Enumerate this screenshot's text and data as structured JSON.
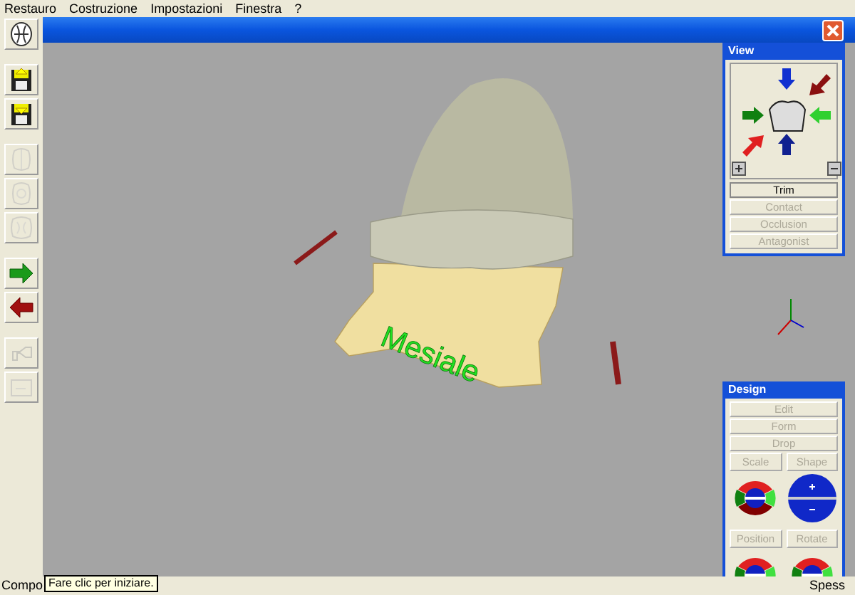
{
  "menu": [
    "Restauro",
    "Costruzione",
    "Impostazioni",
    "Finestra",
    "?"
  ],
  "toolbar_groups": [
    [
      {
        "kind": "occlusal",
        "disabled": false
      }
    ],
    [
      {
        "kind": "save-up",
        "disabled": false
      },
      {
        "kind": "save-down",
        "disabled": false
      }
    ],
    [
      {
        "kind": "tooth-a",
        "disabled": true
      },
      {
        "kind": "tooth-b",
        "disabled": true
      },
      {
        "kind": "tooth-c",
        "disabled": true
      }
    ],
    [
      {
        "kind": "arrow-right",
        "disabled": false
      },
      {
        "kind": "arrow-left",
        "disabled": false
      }
    ],
    [
      {
        "kind": "tool",
        "disabled": true
      },
      {
        "kind": "card",
        "disabled": true
      }
    ]
  ],
  "viewport": {
    "label": "Mesiale"
  },
  "view_panel": {
    "title": "View",
    "buttons": [
      {
        "label": "Trim",
        "disabled": false
      },
      {
        "label": "Contact",
        "disabled": true
      },
      {
        "label": "Occlusion",
        "disabled": true
      },
      {
        "label": "Antagonist",
        "disabled": true
      }
    ]
  },
  "design_panel": {
    "title": "Design",
    "buttons": [
      {
        "label": "Edit",
        "disabled": true
      },
      {
        "label": "Form",
        "disabled": true
      },
      {
        "label": "Drop",
        "disabled": true
      }
    ],
    "controls": [
      {
        "label": "Scale",
        "kind": "ring"
      },
      {
        "label": "Shape",
        "kind": "disc"
      },
      {
        "label": "Position",
        "kind": "ring"
      },
      {
        "label": "Rotate",
        "kind": "ring"
      }
    ]
  },
  "status_bar": {
    "left": "Compo",
    "tooltip": "Fare clic per iniziare.",
    "right": "Spess"
  }
}
